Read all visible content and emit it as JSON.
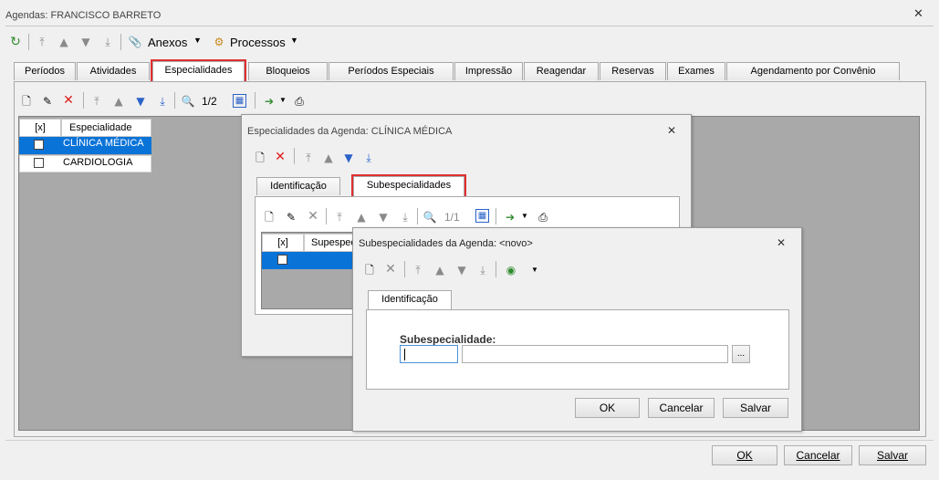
{
  "window": {
    "title": "Agendas: FRANCISCO BARRETO"
  },
  "toolbar": {
    "anexos": "Anexos",
    "processos": "Processos"
  },
  "tabs": [
    "Períodos",
    "Atividades",
    "Especialidades",
    "Bloqueios",
    "Períodos Especiais",
    "Impressão",
    "Reagendar",
    "Reservas",
    "Exames",
    "Agendamento por Convênio"
  ],
  "esp_toolbar": {
    "pager": "1/2"
  },
  "esp_grid": {
    "headers": [
      "[x]",
      "Especialidade"
    ],
    "rows": [
      "CLÍNICA MÉDICA",
      "CARDIOLOGIA"
    ]
  },
  "dlg1": {
    "title": "Especialidades da Agenda: CLÍNICA MÉDICA",
    "tabs": [
      "Identificação",
      "Subespecialidades"
    ],
    "pager": "1/1",
    "grid_headers": [
      "[x]",
      "Supespec"
    ]
  },
  "dlg2": {
    "title": "Subespecialidades da Agenda: <novo>",
    "tab": "Identificação",
    "field_label": "Subespecialidade:",
    "browse": "...",
    "ok": "OK",
    "cancel": "Cancelar",
    "save": "Salvar"
  },
  "footer": {
    "ok": "OK",
    "cancel": "Cancelar",
    "save": "Salvar"
  }
}
